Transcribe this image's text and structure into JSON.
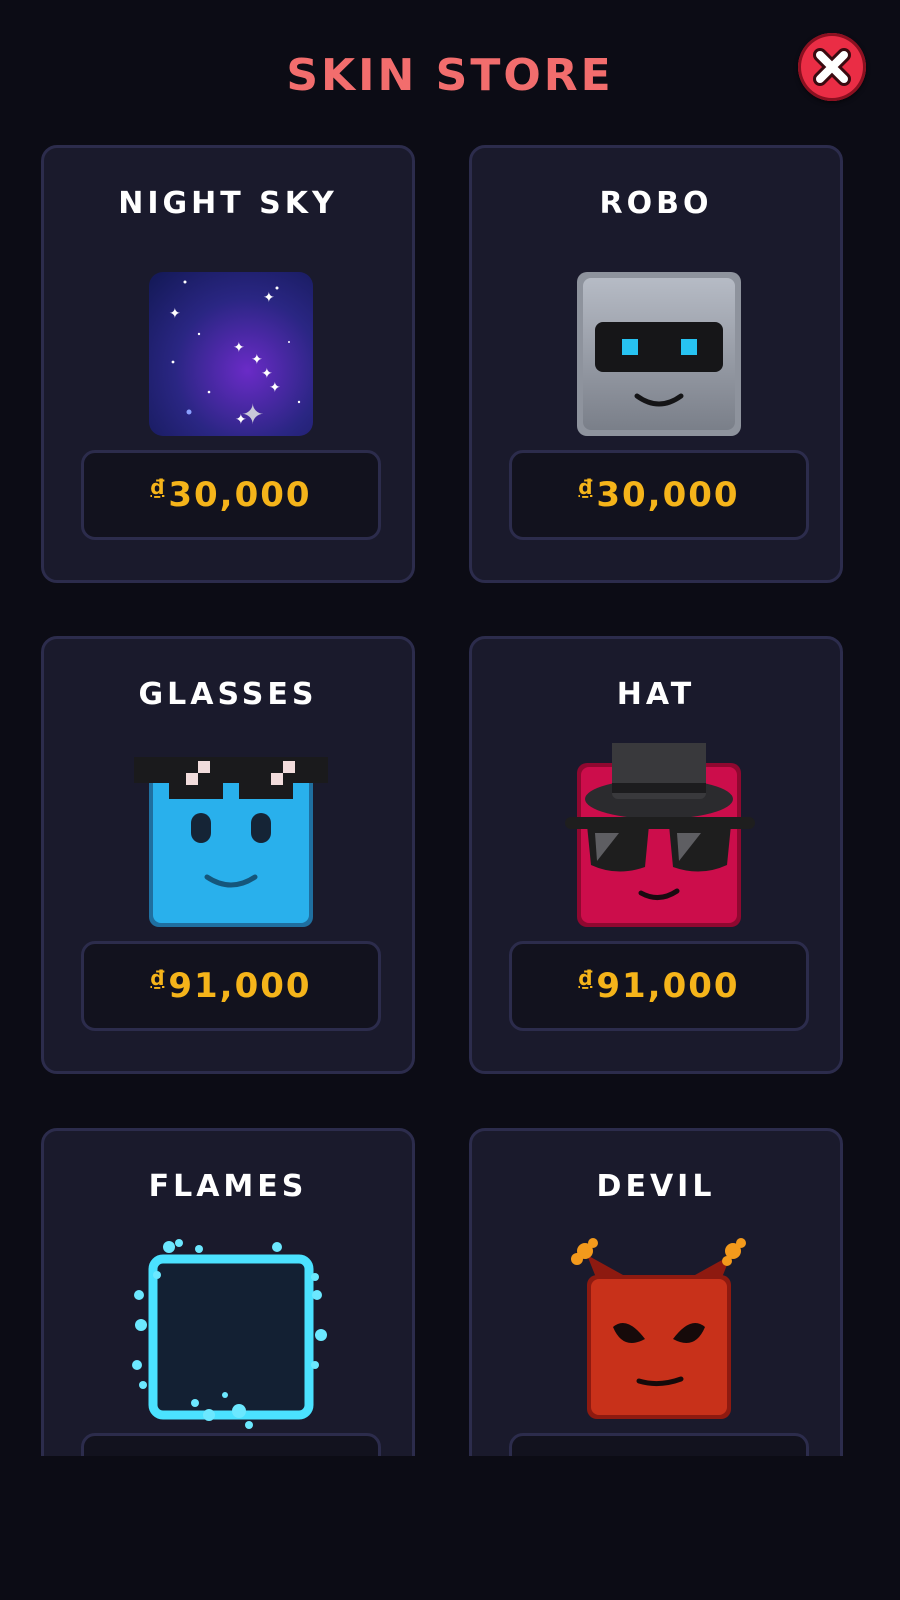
{
  "header": {
    "title": "SKIN STORE"
  },
  "close_icon": "close-icon",
  "accent_color": "#f26d6d",
  "price_color": "#f5b41a",
  "skins": [
    {
      "name": "NIGHT SKY",
      "currency": "₫",
      "price": "30,000",
      "icon": "night-sky-skin-icon"
    },
    {
      "name": "ROBO",
      "currency": "₫",
      "price": "30,000",
      "icon": "robo-skin-icon"
    },
    {
      "name": "GLASSES",
      "currency": "₫",
      "price": "91,000",
      "icon": "glasses-skin-icon"
    },
    {
      "name": "HAT",
      "currency": "₫",
      "price": "91,000",
      "icon": "hat-skin-icon"
    },
    {
      "name": "FLAMES",
      "currency": "",
      "price": "",
      "icon": "flames-skin-icon"
    },
    {
      "name": "DEVIL",
      "currency": "",
      "price": "",
      "icon": "devil-skin-icon"
    }
  ]
}
